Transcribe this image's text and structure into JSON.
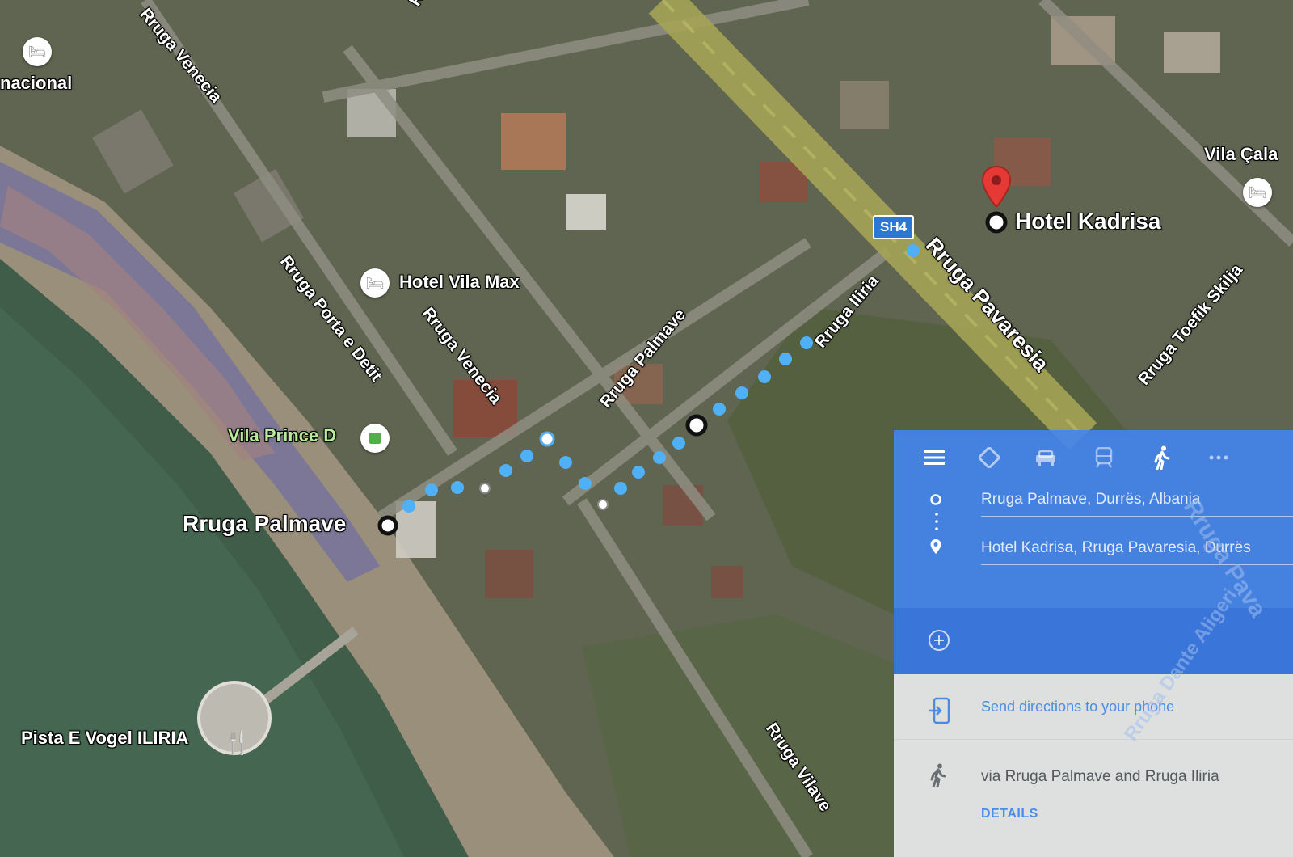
{
  "map": {
    "route_color": "#4fb0f5",
    "streets": {
      "venecia_top": "Rruga Venecia",
      "porta_e_detit": "Rruga Porta e Detit",
      "venecia_mid": "Rruga Venecia",
      "palmave": "Rruga Palmave",
      "iliria": "Rruga Iliria",
      "pavaresia": "Rruga Pavaresia",
      "toefik_skilja": "Rruga Toefik Skilja",
      "vilave": "Rruga Vilave",
      "top_partial": "Rr"
    },
    "places": {
      "nacional": "nacional",
      "hotel_vila_max": "Hotel Vila Max",
      "vila_prince_d": "Vila Prince D",
      "vila_cala": "Vila Çala",
      "pista": "Pista E Vogel ILIRIA",
      "origin": "Rruga Palmave",
      "destination": "Hotel Kadrisa"
    },
    "highway_shield": "SH4"
  },
  "panel": {
    "modes": {
      "menu": "menu-icon",
      "best": "directions-icon",
      "drive": "car-icon",
      "transit": "train-icon",
      "walk": "walk-icon",
      "more": "more-icon"
    },
    "origin": "Rruga Palmave, Durrës, Albania",
    "destination": "Hotel Kadrisa, Rruga Pavaresia, Durrës",
    "send": "Send directions to your phone",
    "via": "via Rruga Palmave and Rruga Iliria",
    "details": "DETAILS",
    "overlay_street_a": "Rruga Pava",
    "overlay_street_b": "Rruga Dante Aligeri"
  }
}
